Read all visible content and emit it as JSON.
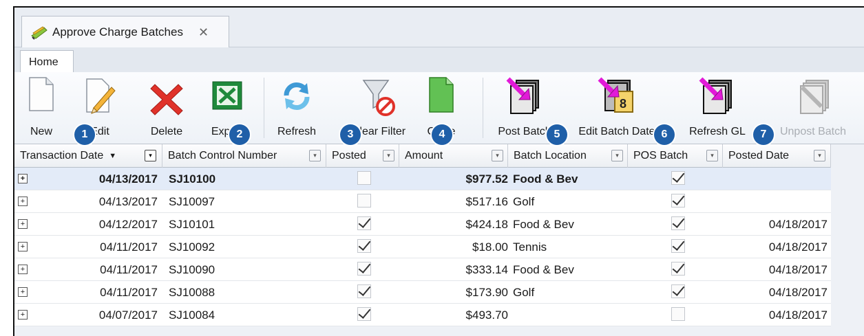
{
  "window": {
    "tab_title": "Approve Charge Batches",
    "close_glyph": "✕"
  },
  "ribbon": {
    "tab_label": "Home",
    "buttons": {
      "new": "New",
      "edit": "Edit",
      "delete": "Delete",
      "export": "Export",
      "refresh": "Refresh",
      "clear_filter": "Clear Filter",
      "close": "Close",
      "post_batch": "Post Batch",
      "edit_batch_date": "Edit Batch Date",
      "refresh_gl": "Refresh GL",
      "unpost_batch": "Unpost Batch"
    },
    "badges": [
      "1",
      "2",
      "3",
      "4",
      "5",
      "6",
      "7"
    ]
  },
  "grid": {
    "columns": {
      "transaction_date": "Transaction Date",
      "sort_indicator": "▼",
      "batch_control_number": "Batch Control Number",
      "posted": "Posted",
      "amount": "Amount",
      "batch_location": "Batch Location",
      "pos_batch": "POS Batch",
      "posted_date": "Posted Date"
    },
    "filter_glyph": "▾",
    "expand_glyph": "+",
    "rows": [
      {
        "date": "04/13/2017",
        "batch": "SJ10100",
        "posted": false,
        "amount": "$977.52",
        "location": "Food & Bev",
        "pos": true,
        "posted_date": ""
      },
      {
        "date": "04/13/2017",
        "batch": "SJ10097",
        "posted": false,
        "amount": "$517.16",
        "location": "Golf",
        "pos": true,
        "posted_date": ""
      },
      {
        "date": "04/12/2017",
        "batch": "SJ10101",
        "posted": true,
        "amount": "$424.18",
        "location": "Food & Bev",
        "pos": true,
        "posted_date": "04/18/2017"
      },
      {
        "date": "04/11/2017",
        "batch": "SJ10092",
        "posted": true,
        "amount": "$18.00",
        "location": "Tennis",
        "pos": true,
        "posted_date": "04/18/2017"
      },
      {
        "date": "04/11/2017",
        "batch": "SJ10090",
        "posted": true,
        "amount": "$333.14",
        "location": "Food & Bev",
        "pos": true,
        "posted_date": "04/18/2017"
      },
      {
        "date": "04/11/2017",
        "batch": "SJ10088",
        "posted": true,
        "amount": "$173.90",
        "location": "Golf",
        "pos": true,
        "posted_date": "04/18/2017"
      },
      {
        "date": "04/07/2017",
        "batch": "SJ10084",
        "posted": true,
        "amount": "$493.70",
        "location": "",
        "pos": false,
        "posted_date": "04/18/2017"
      }
    ]
  },
  "colors": {
    "badge": "#1f5fa8",
    "focused_row": "#e3ebf8",
    "delete_red": "#e0322a",
    "excel_green": "#1f8a3b",
    "post_magenta": "#e21ad8"
  },
  "icons": {
    "new": "blank-document-icon",
    "edit": "pencil-document-icon",
    "delete": "red-x-icon",
    "export": "excel-icon",
    "refresh": "refresh-arrows-icon",
    "clear_filter": "funnel-clear-icon",
    "close": "green-document-icon",
    "post_batch": "post-batch-icon",
    "edit_batch_date": "calendar-batch-icon",
    "refresh_gl": "refresh-gl-icon",
    "unpost_batch": "unpost-batch-icon"
  }
}
